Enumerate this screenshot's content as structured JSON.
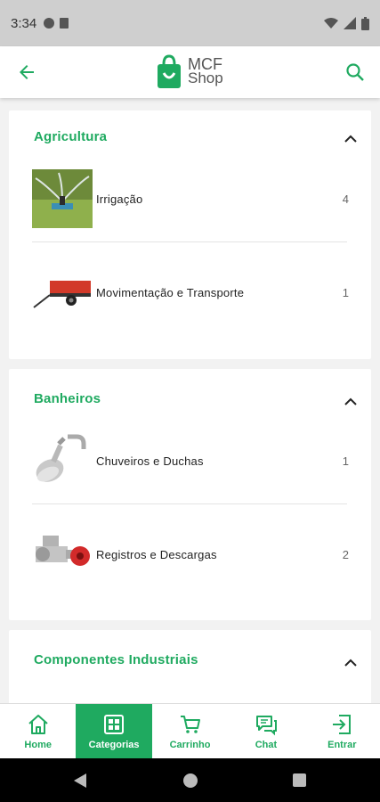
{
  "status_bar": {
    "time": "3:34"
  },
  "app": {
    "logo_line1": "MCF",
    "logo_line2": "Shop"
  },
  "categories": [
    {
      "title": "Agricultura",
      "items": [
        {
          "label": "Irrigação",
          "count": "4",
          "icon": "sprinkler-image"
        },
        {
          "label": "Movimentação e Transporte",
          "count": "1",
          "icon": "trailer-image"
        }
      ]
    },
    {
      "title": "Banheiros",
      "items": [
        {
          "label": "Chuveiros e Duchas",
          "count": "1",
          "icon": "shower-head-image"
        },
        {
          "label": "Registros e Descargas",
          "count": "2",
          "icon": "valve-image"
        }
      ]
    },
    {
      "title": "Componentes Industriais",
      "items": []
    }
  ],
  "bottom_nav": [
    {
      "label": "Home",
      "icon": "home-icon"
    },
    {
      "label": "Categorias",
      "icon": "categories-icon",
      "active": true
    },
    {
      "label": "Carrinho",
      "icon": "cart-icon"
    },
    {
      "label": "Chat",
      "icon": "chat-icon"
    },
    {
      "label": "Entrar",
      "icon": "login-icon"
    }
  ],
  "colors": {
    "accent": "#1faa60",
    "background": "#f2f2f2"
  }
}
